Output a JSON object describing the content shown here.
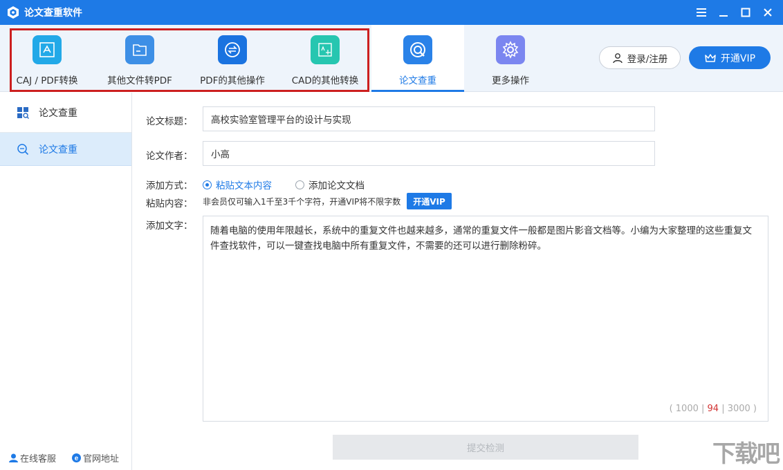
{
  "window": {
    "title": "论文查重软件"
  },
  "toolbar": {
    "tools": [
      {
        "label": "CAJ / PDF转换",
        "color": "#22a9e8",
        "icon": "pdf-convert-icon"
      },
      {
        "label": "其他文件转PDF",
        "color": "#3d8fe6",
        "icon": "folder-icon"
      },
      {
        "label": "PDF的其他操作",
        "color": "#1a73e0",
        "icon": "swap-icon"
      },
      {
        "label": "CAD的其他转换",
        "color": "#26c6b0",
        "icon": "cad-icon"
      },
      {
        "label": "论文查重",
        "color": "#2a82e8",
        "icon": "search-ring-icon"
      },
      {
        "label": "更多操作",
        "color": "#7b86f0",
        "icon": "gear-icon"
      }
    ],
    "login_label": "登录/注册",
    "vip_label": "开通VIP"
  },
  "sidebar": {
    "header": "论文查重",
    "item": "论文查重",
    "footer_service": "在线客服",
    "footer_site": "官网地址"
  },
  "form": {
    "title_label": "论文标题：",
    "title_value": "高校实验室管理平台的设计与实现",
    "author_label": "论文作者：",
    "author_value": "小高",
    "method_label": "添加方式：",
    "method_paste": "粘贴文本内容",
    "method_doc": "添加论文文档",
    "paste_label": "粘贴内容：",
    "paste_hint": "非会员仅可输入1千至3千个字符，开通VIP将不限字数",
    "paste_vip": "开通VIP",
    "text_label": "添加文字：",
    "text_value": "随着电脑的使用年限越长，系统中的重复文件也越来越多，通常的重复文件一般都是图片影音文档等。小编为大家整理的这些重复文件查找软件，可以一键查找电脑中所有重复文件，不需要的还可以进行删除粉碎。",
    "counter_open": "( 1000 | ",
    "counter_current": "94",
    "counter_close": " | 3000 )",
    "submit": "提交检测"
  },
  "watermark": "下载吧"
}
